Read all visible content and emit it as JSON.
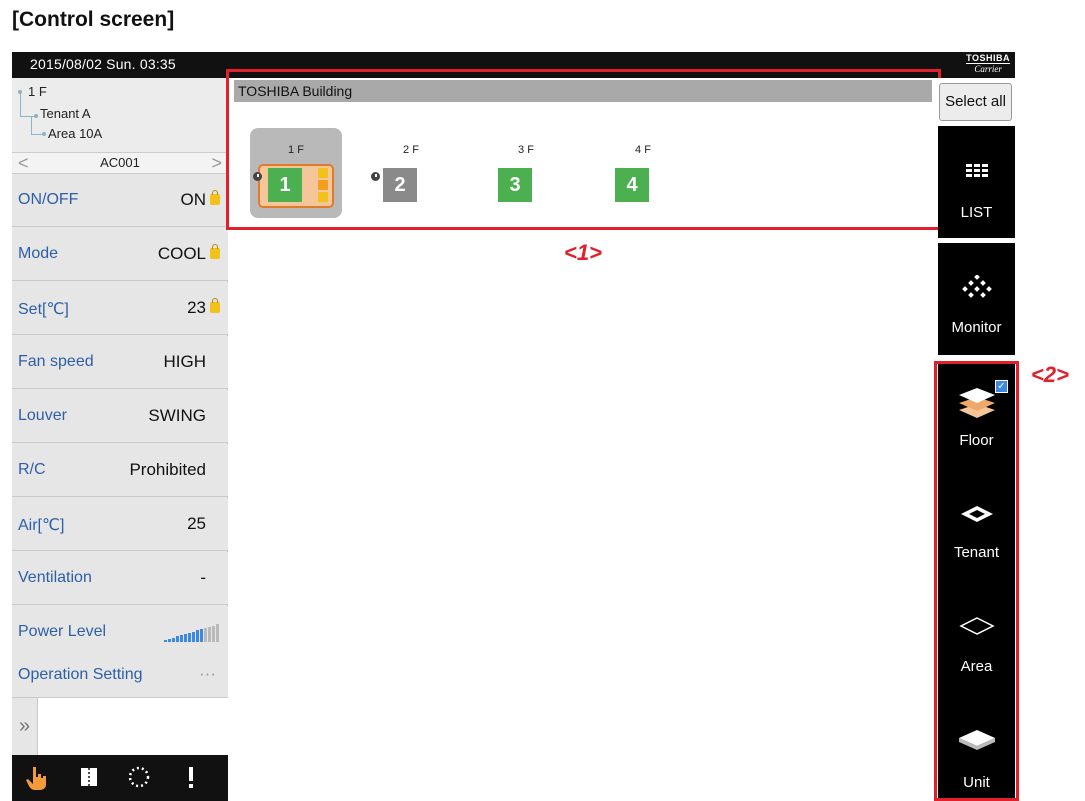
{
  "caption": "[Control screen]",
  "header": {
    "datetime": "2015/08/02 Sun. 03:35",
    "brand_line1": "TOSHIBA",
    "brand_line2": "Carrier"
  },
  "tree": {
    "floor": "1 F",
    "tenant": "Tenant A",
    "area": "Area 10A"
  },
  "unit_selector": {
    "name": "AC001",
    "prev": "<",
    "next": ">"
  },
  "status_rows": [
    {
      "label": "ON/OFF",
      "value": "ON",
      "locked": true
    },
    {
      "label": "Mode",
      "value": "COOL",
      "locked": true
    },
    {
      "label": "Set[℃]",
      "value": "23",
      "locked": true
    },
    {
      "label": "Fan speed",
      "value": "HIGH",
      "locked": false
    },
    {
      "label": "Louver",
      "value": "SWING",
      "locked": false
    },
    {
      "label": "R/C",
      "value": "Prohibited",
      "locked": false
    },
    {
      "label": "Air[℃]",
      "value": "25",
      "locked": false
    },
    {
      "label": "Ventilation",
      "value": "-",
      "locked": false
    },
    {
      "label": "Power Level",
      "value": "",
      "locked": false
    },
    {
      "label": "Operation Setting",
      "value": "···",
      "locked": false
    }
  ],
  "power_level_fraction": 0.7,
  "expander_icon": "»",
  "building": {
    "name": "TOSHIBA Building",
    "floors": [
      {
        "label": "1 F",
        "number": "1",
        "color": "#4caf50",
        "selected": true,
        "timer": true
      },
      {
        "label": "2 F",
        "number": "2",
        "color": "#8a8a8a",
        "selected": false,
        "timer": true
      },
      {
        "label": "3 F",
        "number": "3",
        "color": "#4caf50",
        "selected": false,
        "timer": false
      },
      {
        "label": "4 F",
        "number": "4",
        "color": "#4caf50",
        "selected": false,
        "timer": false
      }
    ]
  },
  "annotations": {
    "label1": "<1>",
    "label2": "<2>",
    "color": "#e0202a"
  },
  "right_panel": {
    "select_all": "Select all",
    "list_label": "LIST",
    "monitor_label": "Monitor",
    "views": [
      {
        "label": "Floor",
        "checked": true
      },
      {
        "label": "Tenant",
        "checked": false
      },
      {
        "label": "Area",
        "checked": false
      },
      {
        "label": "Unit",
        "checked": false
      }
    ]
  },
  "bottom_icons": [
    "hand-icon",
    "book-icon",
    "progress-icon",
    "alert-icon"
  ]
}
